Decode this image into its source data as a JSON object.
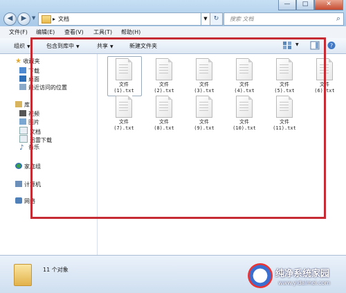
{
  "window": {
    "controls": [
      "—",
      "□",
      "✕"
    ]
  },
  "address": {
    "path": [
      "▸",
      "文档"
    ],
    "search_placeholder": "搜索 文档"
  },
  "menu": [
    "文件(F)",
    "编辑(E)",
    "查看(V)",
    "工具(T)",
    "帮助(H)"
  ],
  "toolbar": {
    "organize": "组织",
    "include_library": "包含到库中",
    "share": "共享",
    "new_folder": "新建文件夹"
  },
  "sidebar": {
    "favorites_label": "收藏夹",
    "favorites": [
      "下载",
      "桌面",
      "最近访问的位置"
    ],
    "libraries_label": "库",
    "libraries": [
      "视频",
      "图片",
      "文档",
      "迅雷下载",
      "音乐"
    ],
    "homegroup": "家庭组",
    "computer": "计算机",
    "network": "网络"
  },
  "files": [
    {
      "line1": "文件",
      "line2": "(1).txt"
    },
    {
      "line1": "文件",
      "line2": "(2).txt"
    },
    {
      "line1": "文件",
      "line2": "(3).txt"
    },
    {
      "line1": "文件",
      "line2": "(4).txt"
    },
    {
      "line1": "文件",
      "line2": "(5).txt"
    },
    {
      "line1": "文件",
      "line2": "(6).txt"
    },
    {
      "line1": "文件",
      "line2": "(7).txt"
    },
    {
      "line1": "文件",
      "line2": "(8).txt"
    },
    {
      "line1": "文件",
      "line2": "(9).txt"
    },
    {
      "line1": "文件",
      "line2": "(10).txt"
    },
    {
      "line1": "文件",
      "line2": "(11).txt"
    }
  ],
  "status": {
    "count": "11 个对象"
  },
  "watermark": {
    "title": "纯净系统家园",
    "url": "www.yidaimei.com"
  },
  "colors": {
    "highlight_box": "#c62a33"
  }
}
